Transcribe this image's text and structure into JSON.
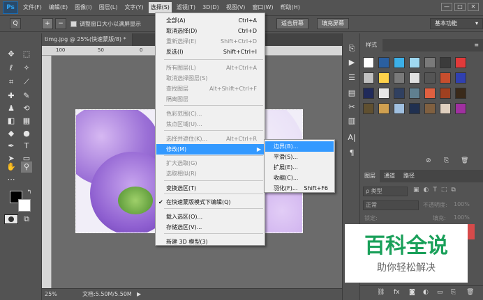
{
  "menubar": {
    "logo": "Ps",
    "items": [
      "文件(F)",
      "编辑(E)",
      "图像(I)",
      "图层(L)",
      "文字(Y)",
      "选择(S)",
      "滤镜(T)",
      "3D(D)",
      "视图(V)",
      "窗口(W)",
      "帮助(H)"
    ],
    "active_index": 5,
    "win_buttons": [
      "—",
      "□",
      "✕"
    ]
  },
  "options": {
    "zoom_icon": "Q",
    "resize_label": "调整窗口大小以满屏显示",
    "fit_screen": "适合屏幕",
    "fill_screen": "填充屏幕",
    "workspace": "基本功能"
  },
  "document": {
    "tab_title": "timg.jpg @ 25%(快速蒙版/8) *",
    "tab_close": "✕",
    "ruler_marks": [
      "100",
      "50",
      "0",
      "50",
      "100"
    ],
    "zoom": "25%",
    "doc_size": "文档:5.50M/5.50M"
  },
  "select_menu": {
    "items": [
      {
        "label": "全部(A)",
        "shortcut": "Ctrl+A",
        "disabled": false
      },
      {
        "label": "取消选择(D)",
        "shortcut": "Ctrl+D",
        "disabled": false
      },
      {
        "label": "重新选择(E)",
        "shortcut": "Shift+Ctrl+D",
        "disabled": true
      },
      {
        "label": "反选(I)",
        "shortcut": "Shift+Ctrl+I",
        "disabled": false
      },
      {
        "label": "所有图层(L)",
        "shortcut": "Alt+Ctrl+A",
        "disabled": true
      },
      {
        "label": "取消选择图层(S)",
        "shortcut": "",
        "disabled": true
      },
      {
        "label": "查找图层",
        "shortcut": "Alt+Shift+Ctrl+F",
        "disabled": true
      },
      {
        "label": "隔离图层",
        "shortcut": "",
        "disabled": true
      },
      {
        "label": "色彩范围(C)...",
        "shortcut": "",
        "disabled": true
      },
      {
        "label": "焦点区域(U)...",
        "shortcut": "",
        "disabled": true
      },
      {
        "label": "选择并遮住(K)...",
        "shortcut": "Alt+Ctrl+R",
        "disabled": true
      },
      {
        "label": "修改(M)",
        "shortcut": "",
        "disabled": false,
        "highlighted": true,
        "submenu": true
      },
      {
        "label": "扩大选取(G)",
        "shortcut": "",
        "disabled": true
      },
      {
        "label": "选取相似(R)",
        "shortcut": "",
        "disabled": true
      },
      {
        "label": "变换选区(T)",
        "shortcut": "",
        "disabled": false
      },
      {
        "label": "在快速蒙版模式下编辑(Q)",
        "shortcut": "",
        "disabled": false,
        "checked": true
      },
      {
        "label": "载入选区(O)...",
        "shortcut": "",
        "disabled": false
      },
      {
        "label": "存储选区(V)...",
        "shortcut": "",
        "disabled": false
      },
      {
        "label": "新建 3D 模型(3)",
        "shortcut": "",
        "disabled": false
      }
    ],
    "submenu_arrow": "▶",
    "check_mark": "✔"
  },
  "modify_submenu": {
    "items": [
      {
        "label": "边界(B)...",
        "shortcut": "",
        "highlighted": true
      },
      {
        "label": "平滑(S)...",
        "shortcut": ""
      },
      {
        "label": "扩展(E)...",
        "shortcut": ""
      },
      {
        "label": "收缩(C)...",
        "shortcut": ""
      },
      {
        "label": "羽化(F)...",
        "shortcut": "Shift+F6"
      }
    ]
  },
  "styles_panel": {
    "title": "样式"
  },
  "layers_panel": {
    "tabs": [
      "图层",
      "通道",
      "路径"
    ],
    "kind_label": "ρ 类型",
    "blend_mode": "正常",
    "opacity_label": "不透明度:",
    "opacity_value": "100%",
    "lock_label": "锁定:",
    "fill_label": "填充:",
    "fill_value": "100%"
  },
  "watermark": {
    "title": "百科全说",
    "subtitle": "助你轻松解决"
  },
  "colors": {
    "menu_highlight": "#3399ff",
    "ps_blue": "#2fa3f0",
    "watermark_green": "#1aa05a"
  }
}
